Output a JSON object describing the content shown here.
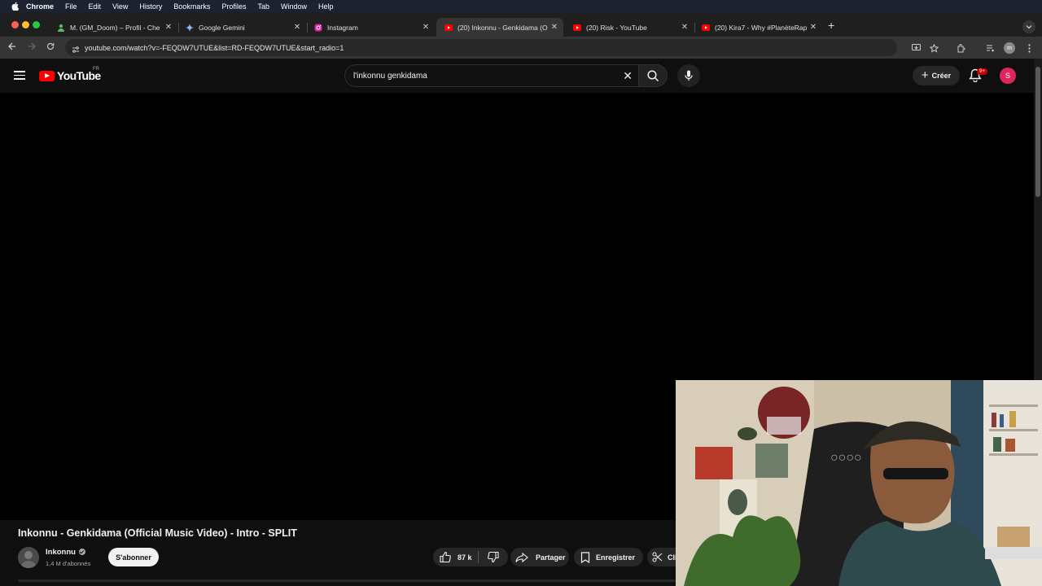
{
  "menubar": {
    "app": "Chrome",
    "items": [
      "File",
      "Edit",
      "View",
      "History",
      "Bookmarks",
      "Profiles",
      "Tab",
      "Window",
      "Help"
    ]
  },
  "tabs": [
    {
      "title": "M. (GM_Doom) – Profil - Che",
      "icon": "person-icon",
      "active": false
    },
    {
      "title": "Google Gemini",
      "icon": "gemini-icon",
      "active": false
    },
    {
      "title": "Instagram",
      "icon": "instagram-icon",
      "active": false
    },
    {
      "title": "(20) Inkonnu - Genkidama (O",
      "icon": "youtube-icon",
      "active": true
    },
    {
      "title": "(20) Risk - YouTube",
      "icon": "youtube-icon",
      "active": false
    },
    {
      "title": "(20) Kira7 - Why #PlanèteRap",
      "icon": "youtube-icon",
      "active": false
    }
  ],
  "address": {
    "url": "youtube.com/watch?v=-FEQDW7UTUE&list=RD-FEQDW7UTUE&start_radio=1"
  },
  "youtube": {
    "logo_text": "YouTube",
    "country_code": "FR",
    "search_value": "l'inkonnu genkidama",
    "create_label": "Créer",
    "notif_badge": "9+",
    "avatar_letter": "S"
  },
  "video": {
    "title": "Inkonnu - Genkidama (Official Music Video) - Intro - SPLIT",
    "channel": "Inkonnu",
    "subscribers": "1,4 M d'abonnés",
    "subscribe_label": "S'abonner",
    "likes": "87 k",
    "share_label": "Partager",
    "save_label": "Enregistrer",
    "clip_label": "Cli"
  },
  "colors": {
    "yt_red": "#ff0000",
    "bg": "#0f0f0f",
    "avatar": "#e0245e"
  }
}
